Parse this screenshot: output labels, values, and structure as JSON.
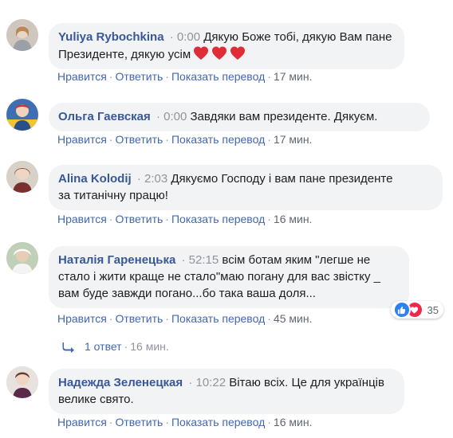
{
  "comments": [
    {
      "author": "Yuliya Rybochkina",
      "timestamp": "0:00",
      "text_lines": [
        "Дякую Боже тобі, дякую Вам пане",
        "Президенте, дякую усім"
      ],
      "emoji": [
        "red-heart",
        "red-heart",
        "red-heart"
      ],
      "actions": {
        "like": "Нравится",
        "reply": "Ответить",
        "translate": "Показать перевод",
        "time": "17 мин."
      }
    },
    {
      "author": "Ольга Гаевская",
      "timestamp": "0:00",
      "text_lines": [
        "Завдяки вам президенте. Дякуєм."
      ],
      "actions": {
        "like": "Нравится",
        "reply": "Ответить",
        "translate": "Показать перевод",
        "time": "17 мин."
      }
    },
    {
      "author": "Alina Kolodij",
      "timestamp": "2:03",
      "text_lines": [
        "Дякуємо Господу і вам пане президенте",
        "за титанічну працю!"
      ],
      "actions": {
        "like": "Нравится",
        "reply": "Ответить",
        "translate": "Показать перевод",
        "time": "16 мин."
      }
    },
    {
      "author": "Наталія Гаренецька",
      "timestamp": "52:15",
      "text_lines": [
        "всім ботам яким \"легше не",
        "стало і жити краще не стало\"маю погану для вас звістку _",
        "вам буде завжди погано...бо така ваша доля..."
      ],
      "reactions": {
        "count": "35",
        "types": [
          "like",
          "love"
        ]
      },
      "actions": {
        "like": "Нравится",
        "reply": "Ответить",
        "translate": "Показать перевод",
        "time": "45 мин."
      }
    },
    {
      "author": "Надежда Зеленецкая",
      "timestamp": "10:22",
      "text_lines": [
        "Вітаю всіх. Це для українців",
        "велике свято."
      ],
      "actions": {
        "like": "Нравится",
        "reply": "Ответить",
        "translate": "Показать перевод",
        "time": "16 мин."
      }
    }
  ],
  "replies": {
    "label": "1 ответ",
    "time": "16 мин."
  },
  "colors": {
    "author": "#385898",
    "link": "#4267b2",
    "muted": "#90949c",
    "bubble": "#f2f3f5",
    "like": "#2e81f4",
    "love": "#f0284a"
  }
}
